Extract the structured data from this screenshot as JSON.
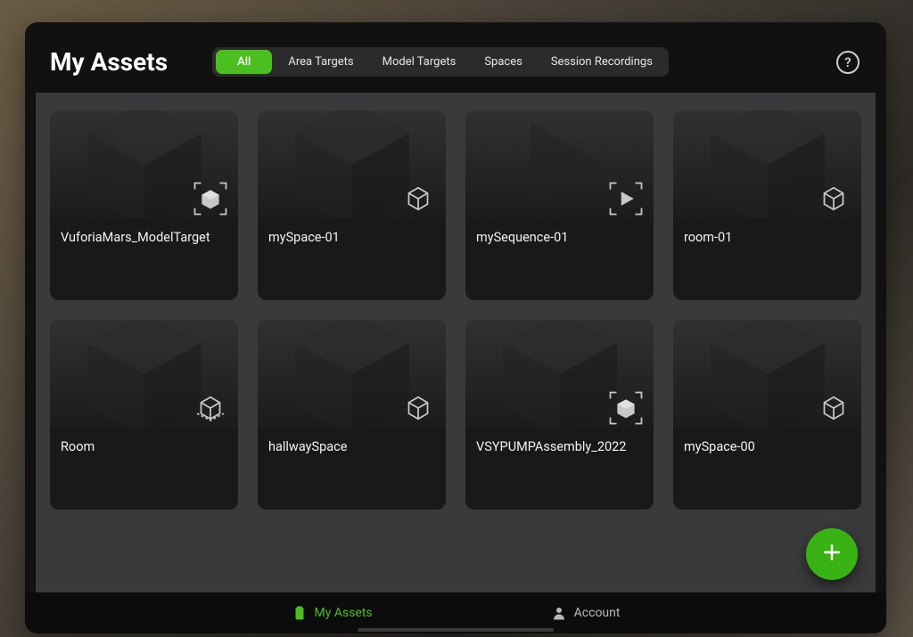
{
  "header": {
    "title": "My Assets"
  },
  "filters": {
    "active_index": 0,
    "tabs": [
      {
        "label": "All"
      },
      {
        "label": "Area Targets"
      },
      {
        "label": "Model Targets"
      },
      {
        "label": "Spaces"
      },
      {
        "label": "Session Recordings"
      }
    ]
  },
  "help_button": {
    "glyph": "?"
  },
  "assets": [
    {
      "title": "VuforiaMars_ModelTarget",
      "type": "model-target",
      "bg": "cube"
    },
    {
      "title": "mySpace-01",
      "type": "space",
      "bg": "cube"
    },
    {
      "title": "mySequence-01",
      "type": "recording",
      "bg": "play"
    },
    {
      "title": "room-01",
      "type": "space",
      "bg": "cube"
    },
    {
      "title": "Room",
      "type": "area-target",
      "bg": "cube"
    },
    {
      "title": "hallwaySpace",
      "type": "space",
      "bg": "cube"
    },
    {
      "title": "VSYPUMPAssembly_2022",
      "type": "model-target",
      "bg": "cube"
    },
    {
      "title": "mySpace-00",
      "type": "space",
      "bg": "cube"
    }
  ],
  "fab": {
    "action_name": "add-asset"
  },
  "bottom_nav": {
    "items": [
      {
        "label": "My Assets",
        "icon": "assets-icon",
        "active": true
      },
      {
        "label": "Account",
        "icon": "account-icon",
        "active": false
      }
    ]
  },
  "colors": {
    "accent": "#4bbf20"
  }
}
